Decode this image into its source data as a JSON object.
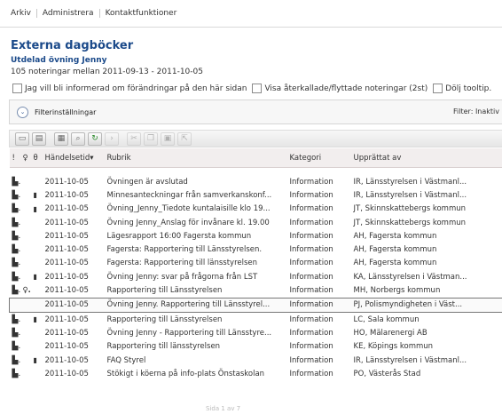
{
  "menu": {
    "items": [
      "Arkiv",
      "Administrera",
      "Kontaktfunktioner"
    ]
  },
  "page": {
    "title": "Externa dagböcker",
    "subtitle": "Utdelad övning Jenny",
    "range": "105 noteringar mellan 2011-09-13 - 2011-10-05"
  },
  "options": {
    "notify": "Jag vill bli informerad om förändringar på den här sidan",
    "show_recalled": "Visa återkallade/flyttade noteringar (2st)",
    "hide_tooltip": "Dölj tooltip."
  },
  "filter": {
    "toggle_icon": "chevron-down-icon",
    "label": "Filterinställningar",
    "status": "Filter: Inaktiv"
  },
  "toolbar": {
    "icons": [
      "open-icon",
      "folder-icon",
      "print-icon",
      "search-icon",
      "refresh-icon",
      "forward-icon",
      "cut-icon",
      "copy-icon",
      "paste-icon",
      "export-icon"
    ]
  },
  "table": {
    "columns": {
      "priority": "!",
      "flag": "flag-icon",
      "attachment": "attachment-icon",
      "date": "Händelsetid",
      "subject": "Rubrik",
      "category": "Kategori",
      "author": "Upprättat av"
    },
    "rows": [
      {
        "date": "2011-10-05",
        "subject": "Övningen är avslutad",
        "category": "Information",
        "author": "IR, Länsstyrelsen i Västmanl..."
      },
      {
        "date": "2011-10-05",
        "subject": "Minnesanteckningar från samverkanskonf...",
        "category": "Information",
        "author": "IR, Länsstyrelsen i Västmanl..."
      },
      {
        "date": "2011-10-05",
        "subject": "Övning_Jenny_Tiedote kuntalaisille klo 19...",
        "category": "Information",
        "author": "JT, Skinnskattebergs kommun"
      },
      {
        "date": "2011-10-05",
        "subject": "Övning Jenny_Anslag för invånare kl. 19.00",
        "category": "Information",
        "author": "JT, Skinnskattebergs kommun"
      },
      {
        "date": "2011-10-05",
        "subject": "Lägesrapport 16:00 Fagersta kommun",
        "category": "Information",
        "author": "AH, Fagersta kommun"
      },
      {
        "date": "2011-10-05",
        "subject": "Fagersta: Rapportering till Länsstyrelsen.",
        "category": "Information",
        "author": "AH, Fagersta kommun"
      },
      {
        "date": "2011-10-05",
        "subject": "Fagersta: Rapportering till länsstyrelsen",
        "category": "Information",
        "author": "AH, Fagersta kommun"
      },
      {
        "date": "2011-10-05",
        "subject": "Övning Jenny: svar på frågorna från LST",
        "category": "Information",
        "author": "KA, Länsstyrelsen i Västman..."
      },
      {
        "date": "2011-10-05",
        "subject": "Rapportering till Länsstyrelsen",
        "category": "Information",
        "author": "MH, Norbergs kommun"
      },
      {
        "date": "2011-10-05",
        "subject": "Övning Jenny. Rapportering till Länsstyrel...",
        "category": "Information",
        "author": "PJ, Polismyndigheten i Väst..."
      },
      {
        "date": "2011-10-05",
        "subject": "Rapportering till Länsstyrelsen",
        "category": "Information",
        "author": "LC, Sala kommun"
      },
      {
        "date": "2011-10-05",
        "subject": "Övning Jenny - Rapportering till Länsstyre...",
        "category": "Information",
        "author": "HO, Mälarenergi AB"
      },
      {
        "date": "2011-10-05",
        "subject": "Rapportering till länsstyrelsen",
        "category": "Information",
        "author": "KE, Köpings kommun"
      },
      {
        "date": "2011-10-05",
        "subject": "FAQ Styrel",
        "category": "Information",
        "author": "IR, Länsstyrelsen i Västmanl..."
      },
      {
        "date": "2011-10-05",
        "subject": "Stökigt i köerna på info-plats Önstaskolan",
        "category": "Information",
        "author": "PO, Västerås Stad"
      }
    ]
  },
  "pager": {
    "label": "Sida 1 av 7"
  }
}
